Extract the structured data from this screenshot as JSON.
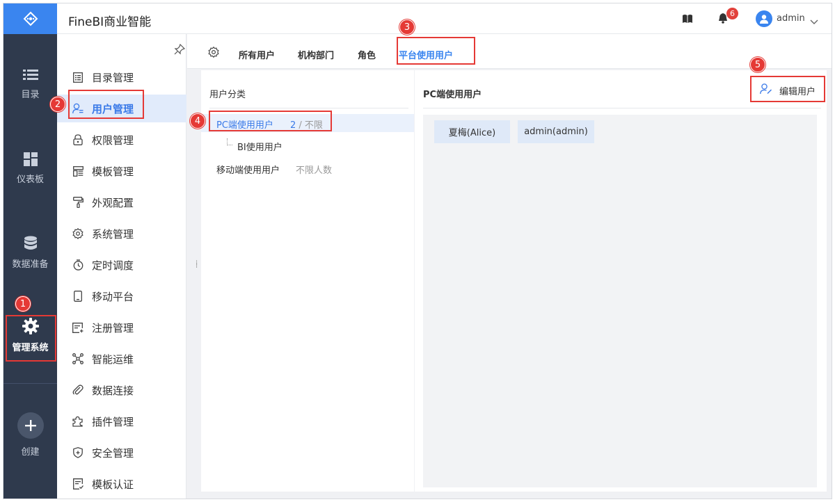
{
  "app": {
    "title": "FineBI商业智能"
  },
  "header": {
    "notification_count": "6",
    "user_name": "admin"
  },
  "rail": {
    "items": [
      {
        "label": "目录",
        "icon": "list-icon"
      },
      {
        "label": "仪表板",
        "icon": "dashboard-icon"
      },
      {
        "label": "数据准备",
        "icon": "database-icon"
      },
      {
        "label": "管理系统",
        "icon": "gear-icon"
      },
      {
        "label": "创建",
        "icon": "plus-icon"
      }
    ],
    "active": "管理系统"
  },
  "menu": {
    "items": [
      {
        "label": "目录管理",
        "icon": "catalog-icon"
      },
      {
        "label": "用户管理",
        "icon": "user-icon"
      },
      {
        "label": "权限管理",
        "icon": "lock-icon"
      },
      {
        "label": "模板管理",
        "icon": "template-icon"
      },
      {
        "label": "外观配置",
        "icon": "paint-icon"
      },
      {
        "label": "系统管理",
        "icon": "settings-icon"
      },
      {
        "label": "定时调度",
        "icon": "timer-icon"
      },
      {
        "label": "移动平台",
        "icon": "mobile-icon"
      },
      {
        "label": "注册管理",
        "icon": "register-icon"
      },
      {
        "label": "智能运维",
        "icon": "ops-icon"
      },
      {
        "label": "数据连接",
        "icon": "link-icon"
      },
      {
        "label": "插件管理",
        "icon": "plugin-icon"
      },
      {
        "label": "安全管理",
        "icon": "shield-icon"
      },
      {
        "label": "模板认证",
        "icon": "certificate-icon"
      }
    ],
    "active": "用户管理"
  },
  "tabs": {
    "items": [
      "所有用户",
      "机构部门",
      "角色",
      "平台使用用户"
    ],
    "active": "平台使用用户"
  },
  "left_panel": {
    "title": "用户分类",
    "tree": [
      {
        "label": "PC端使用用户",
        "count": "2",
        "limit": "/ 不限",
        "selected": true
      },
      {
        "label": "BI使用用户",
        "child": true
      },
      {
        "label": "移动端使用用户",
        "limit": "不限人数"
      }
    ]
  },
  "right_panel": {
    "title": "PC端使用用户",
    "edit_label": "编辑用户",
    "users": [
      "夏梅(Alice)",
      "admin(admin)"
    ]
  },
  "annotations": [
    "1",
    "2",
    "3",
    "4",
    "5"
  ],
  "colors": {
    "accent": "#3a85ef",
    "rail_bg": "#2f3a4d",
    "annotation_red": "#e53935"
  }
}
